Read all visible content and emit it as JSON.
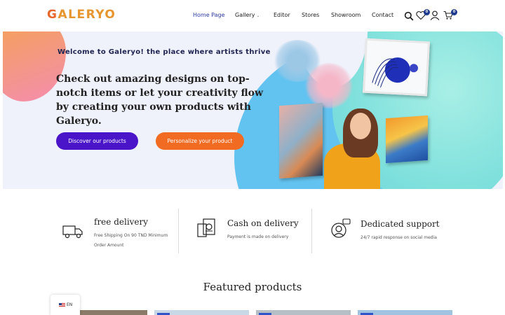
{
  "header": {
    "logo": {
      "first": "G",
      "rest": "ALERYO"
    },
    "nav": [
      "Home Page",
      "Gallery",
      "Editor",
      "Stores",
      "Showroom",
      "Contact"
    ],
    "wishlist_count": "0",
    "cart_count": "0",
    "icons": [
      "search-icon",
      "heart-icon",
      "user-icon",
      "cart-icon"
    ]
  },
  "hero": {
    "welcome": "Welcome to Galeryo! the place where artists thrive",
    "headline": "Check out amazing designs on top-notch items or let your creativity flow by creating your own products with Galeryo.",
    "discover_button": "Discover our products",
    "personalize_button": "Personalize your product"
  },
  "features": [
    {
      "title": "free delivery",
      "desc": "Free Shipping On 90 TND Minimum Order Amount",
      "icon": "truck-icon"
    },
    {
      "title": "Cash on delivery",
      "desc": "Payment is made on delivery",
      "icon": "cash-icon"
    },
    {
      "title": "Dedicated support",
      "desc": "24/7 rapid response on social media",
      "icon": "support-icon"
    }
  ],
  "featured": {
    "title": "Featured products"
  },
  "language": {
    "label": "EN"
  },
  "colors": {
    "accent_purple": "#4a14c8",
    "accent_orange": "#f26b23",
    "logo_orange": "#e9672b",
    "badge_blue": "#1d3a8f"
  }
}
